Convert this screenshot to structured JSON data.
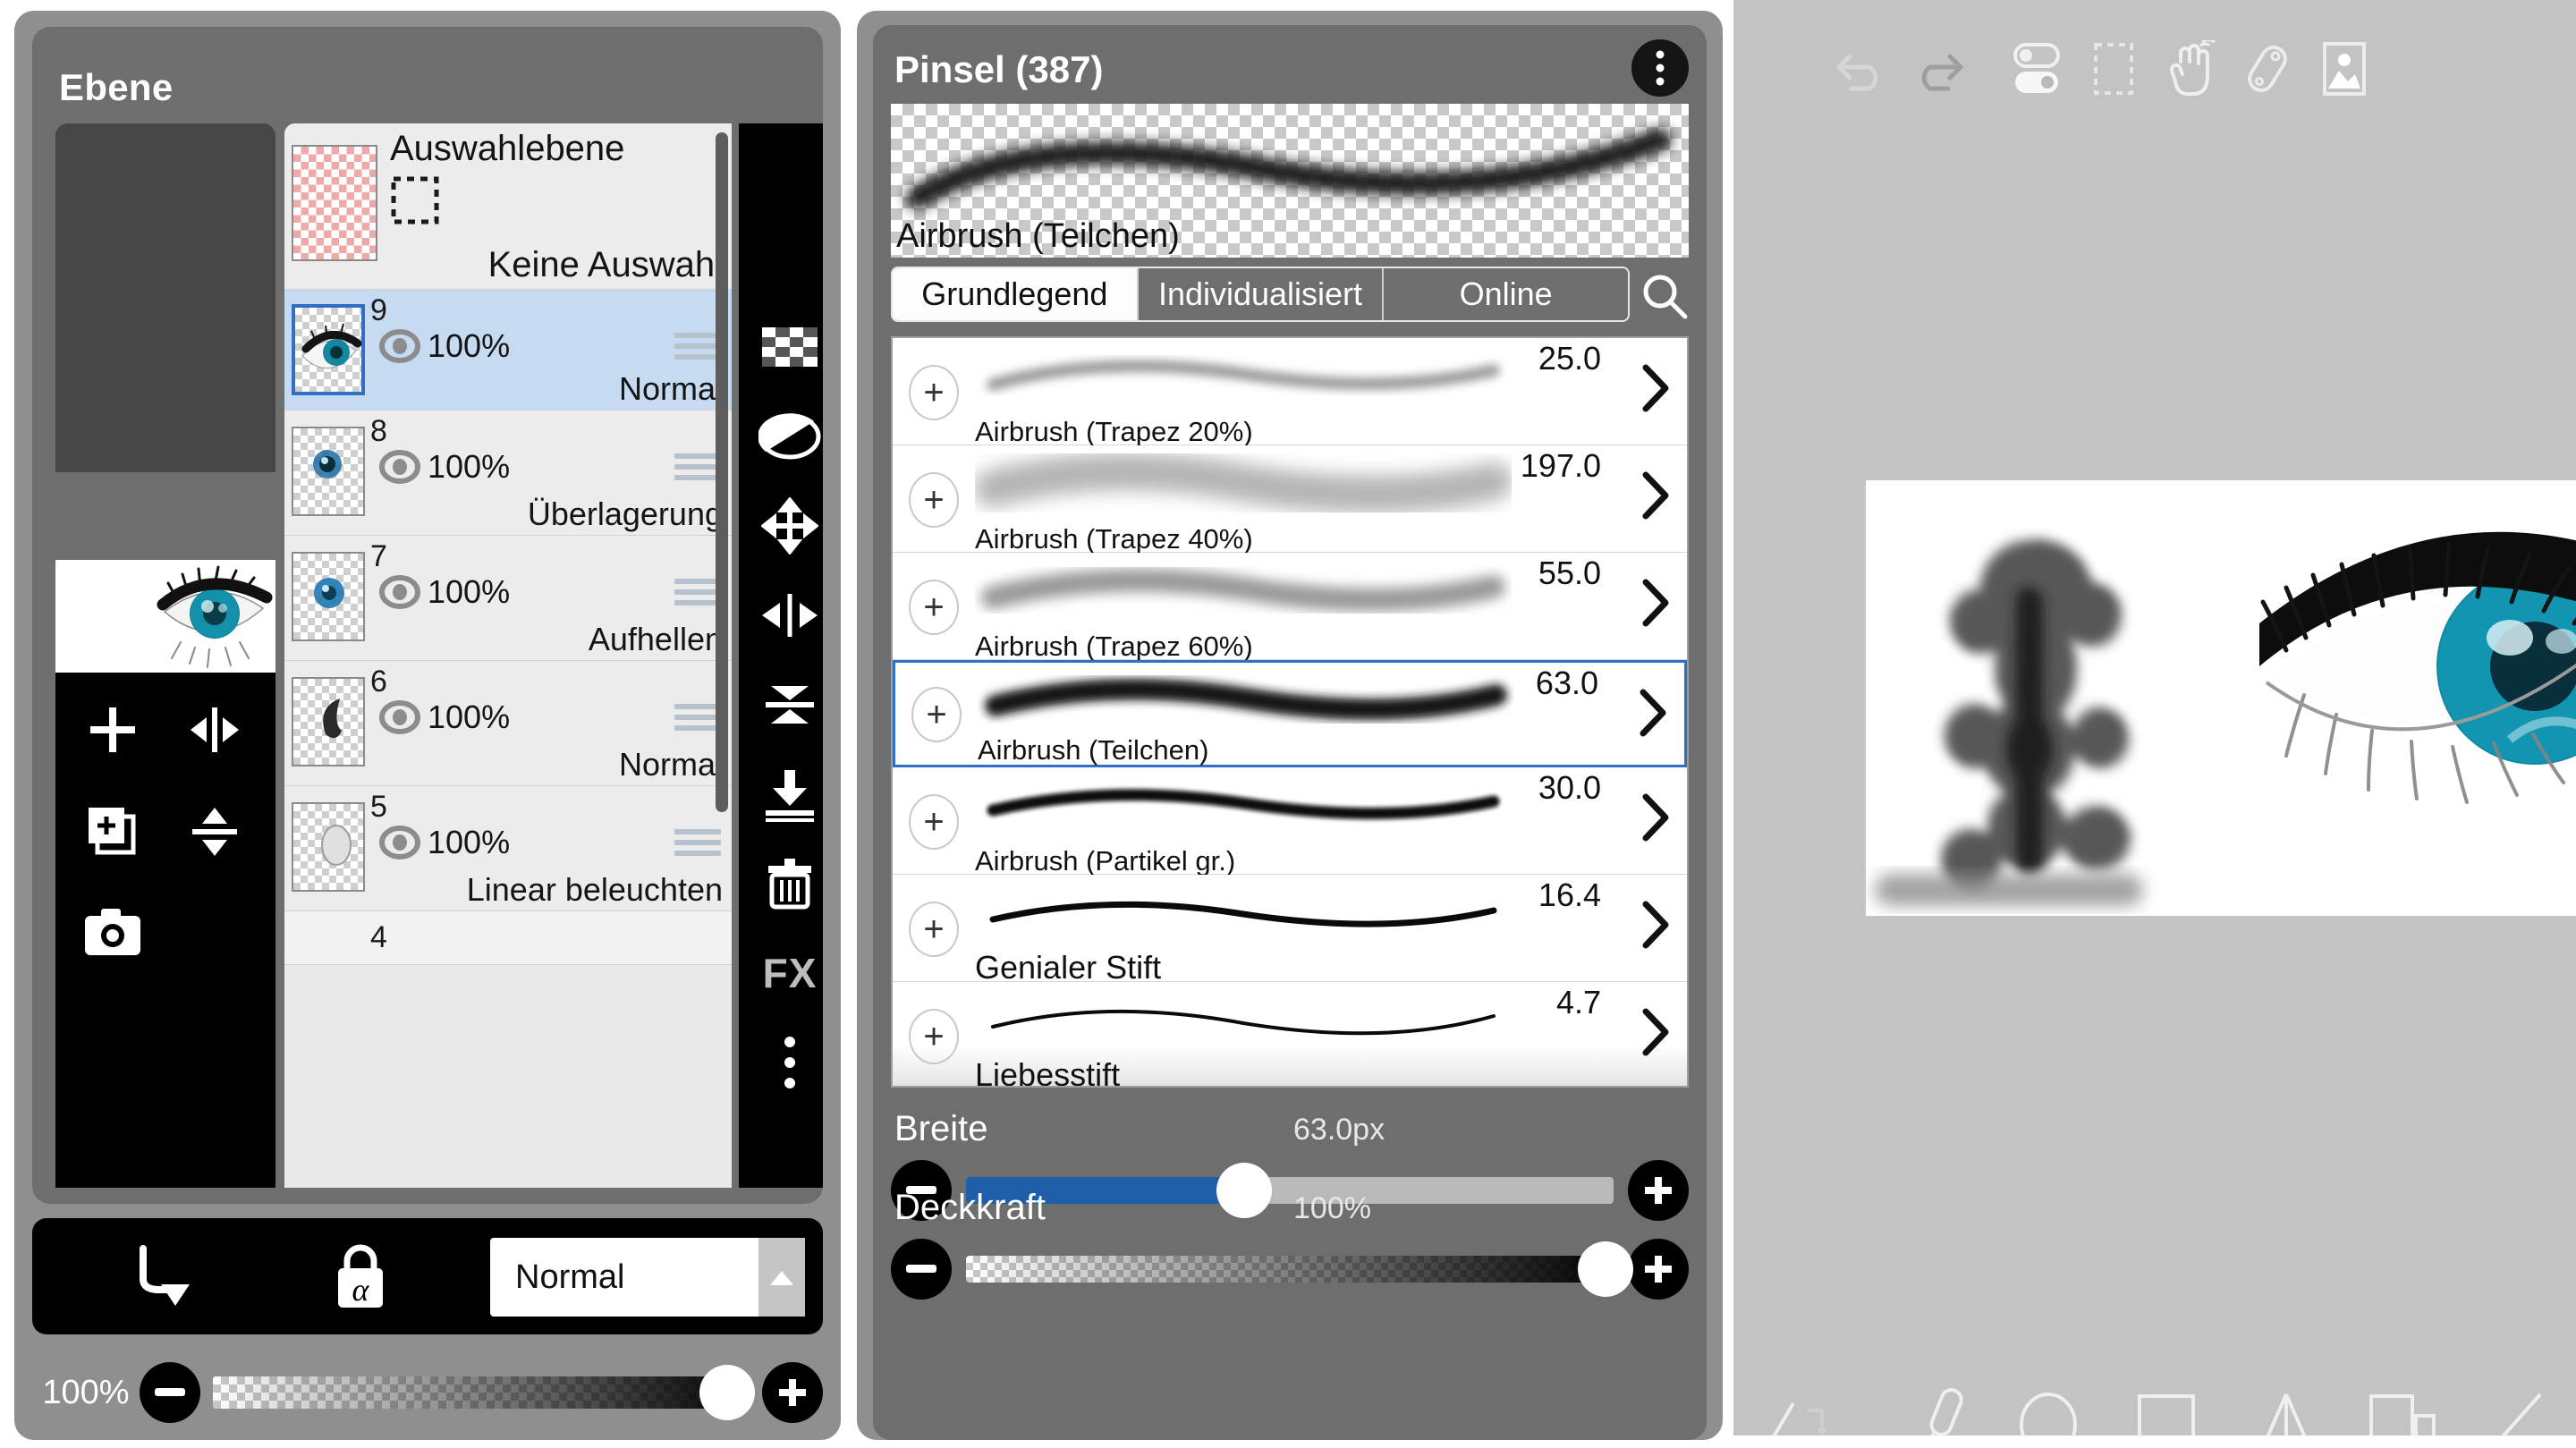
{
  "layers_panel": {
    "title": "Ebene",
    "selection_layer": {
      "name": "Auswahlebene",
      "status": "Keine Auswahl",
      "icon": "marquee-dashed-icon"
    },
    "rows": [
      {
        "num": "9",
        "opacity": "100%",
        "mode": "Normal",
        "selected": true
      },
      {
        "num": "8",
        "opacity": "100%",
        "mode": "Überlagerung",
        "selected": false
      },
      {
        "num": "7",
        "opacity": "100%",
        "mode": "Aufhellen",
        "selected": false
      },
      {
        "num": "6",
        "opacity": "100%",
        "mode": "Normal",
        "selected": false
      },
      {
        "num": "5",
        "opacity": "100%",
        "mode": "Linear beleuchten",
        "selected": false
      },
      {
        "num": "4",
        "opacity": "",
        "mode": "",
        "selected": false
      }
    ],
    "left_tools": [
      {
        "name": "add-layer-button",
        "icon": "plus-icon"
      },
      {
        "name": "flip-horizontal-button",
        "icon": "flip-horizontal-icon"
      },
      {
        "name": "duplicate-layer-button",
        "icon": "duplicate-icon"
      },
      {
        "name": "flip-vertical-button",
        "icon": "flip-vertical-icon"
      },
      {
        "name": "camera-import-button",
        "icon": "camera-icon"
      }
    ],
    "rail_tools": [
      {
        "name": "transparency-button",
        "icon": "checkerboard-icon"
      },
      {
        "name": "clipping-button",
        "icon": "half-circle-icon"
      },
      {
        "name": "move-button",
        "icon": "move-arrows-icon"
      },
      {
        "name": "mirror-button",
        "icon": "mirror-icon"
      },
      {
        "name": "merge-up-button",
        "icon": "collapse-arrows-icon"
      },
      {
        "name": "merge-down-button",
        "icon": "arrow-down-bar-icon"
      },
      {
        "name": "delete-layer-button",
        "icon": "trash-icon"
      },
      {
        "name": "fx-button",
        "icon": "fx-icon",
        "label": "FX"
      },
      {
        "name": "more-options-button",
        "icon": "dots-vertical-icon"
      }
    ],
    "bottom_bar": {
      "clipping_icon": "clipping-arrow-icon",
      "alpha_lock_icon": "alpha-lock-icon",
      "blend_mode": "Normal",
      "blend_arrow_icon": "chevron-up-icon"
    },
    "opacity_row": {
      "value": "100%",
      "minus_icon": "minus-icon",
      "plus_icon": "plus-icon",
      "fill_percent": 100
    }
  },
  "brush_panel": {
    "title": "Pinsel (387)",
    "menu_icon": "dots-vertical-icon",
    "preview_name": "Airbrush (Teilchen)",
    "tabs": [
      {
        "label": "Grundlegend",
        "active": true
      },
      {
        "label": "Individualisiert",
        "active": false
      },
      {
        "label": "Online",
        "active": false
      }
    ],
    "search_icon": "search-icon",
    "brushes": [
      {
        "name": "Airbrush (Trapez 20%)",
        "size": "25.0",
        "selected": false,
        "style": "soft-light",
        "width": 16,
        "opacity": 0.35
      },
      {
        "name": "Airbrush (Trapez 40%)",
        "size": "197.0",
        "selected": false,
        "style": "soft-wide",
        "width": 46,
        "opacity": 0.3
      },
      {
        "name": "Airbrush (Trapez 60%)",
        "size": "55.0",
        "selected": false,
        "style": "soft-med",
        "width": 30,
        "opacity": 0.45
      },
      {
        "name": "Airbrush (Teilchen)",
        "size": "63.0",
        "selected": true,
        "style": "particle",
        "width": 26,
        "opacity": 0.95
      },
      {
        "name": "Airbrush (Partikel gr.)",
        "size": "30.0",
        "selected": false,
        "style": "particle-sm",
        "width": 15,
        "opacity": 0.95
      },
      {
        "name": "Genialer Stift",
        "size": "16.4",
        "selected": false,
        "style": "pen",
        "width": 8,
        "opacity": 1.0
      },
      {
        "name": "Liebesstift",
        "size": "4.7",
        "selected": false,
        "style": "thin-pen",
        "width": 5,
        "opacity": 1.0
      }
    ],
    "row_add_icon": "plus-circle-icon",
    "row_chevron_icon": "chevron-right-icon",
    "width_slider": {
      "label": "Breite",
      "value": "63.0px",
      "fill_percent": 43,
      "minus_icon": "minus-icon",
      "plus_icon": "plus-icon"
    },
    "opacity_slider": {
      "label": "Deckkraft",
      "value": "100%",
      "fill_percent": 100,
      "minus_icon": "minus-icon",
      "plus_icon": "plus-icon"
    }
  },
  "canvas_panel": {
    "top_tools": [
      {
        "name": "undo-button",
        "icon": "undo-icon",
        "disabled": true
      },
      {
        "name": "redo-button",
        "icon": "redo-icon",
        "disabled": false
      },
      {
        "name": "layers-toggle-button",
        "icon": "layers-toggle-icon",
        "disabled": false
      },
      {
        "name": "selection-button",
        "icon": "marquee-dashed-icon",
        "disabled": false
      },
      {
        "name": "hand-tool-button",
        "icon": "hand-icon",
        "disabled": false
      },
      {
        "name": "brush-tool-button",
        "icon": "pen-icon",
        "disabled": false
      },
      {
        "name": "import-image-button",
        "icon": "image-import-icon",
        "disabled": false
      }
    ],
    "bottom_tools": [
      {
        "name": "brush-settings-button",
        "icon": "brush-arrow-icon"
      },
      {
        "name": "brush-button",
        "icon": "brush-icon"
      },
      {
        "name": "ellipse-tool-button",
        "icon": "ellipse-icon"
      },
      {
        "name": "rectangle-tool-button",
        "icon": "rectangle-icon"
      },
      {
        "name": "share-button",
        "icon": "share-arrow-icon"
      },
      {
        "name": "layers-button",
        "icon": "layers-stack-icon"
      },
      {
        "name": "back-button",
        "icon": "back-arrow-icon"
      }
    ]
  }
}
